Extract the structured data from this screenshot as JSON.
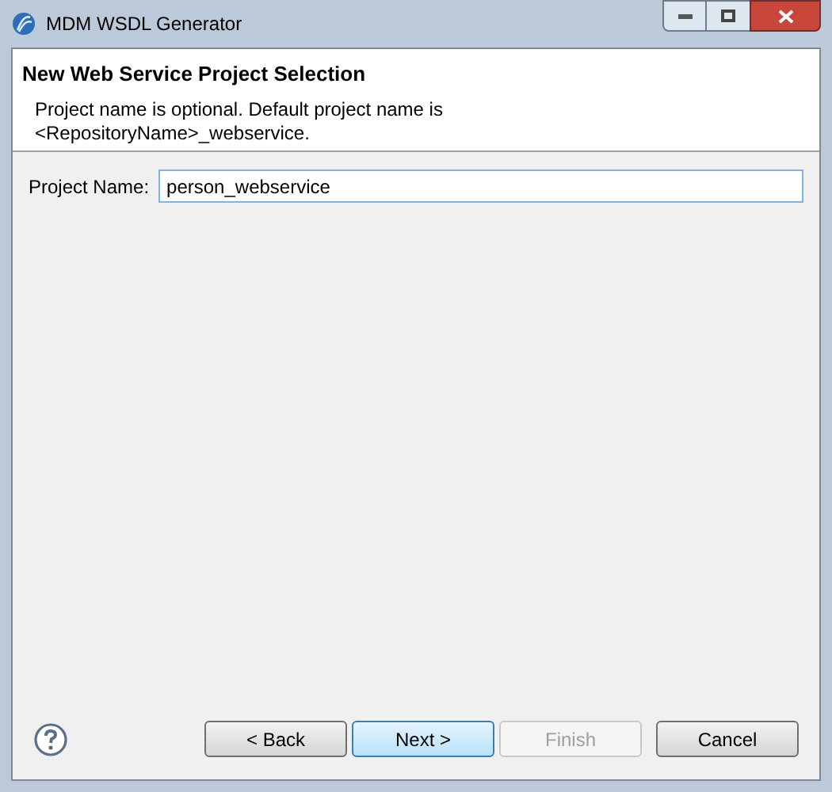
{
  "window": {
    "title": "MDM WSDL Generator"
  },
  "header": {
    "title": "New Web Service Project Selection",
    "message": "Project name is optional. Default project name is <RepositoryName>_webservice."
  },
  "form": {
    "label": "Project Name:",
    "value": "person_webservice"
  },
  "buttons": [
    {
      "label": "< Back",
      "default": false,
      "disabled": false
    },
    {
      "label": "Next >",
      "default": true,
      "disabled": false
    },
    {
      "label": "Finish",
      "default": false,
      "disabled": true
    },
    {
      "label": "Cancel",
      "default": false,
      "disabled": false
    }
  ]
}
